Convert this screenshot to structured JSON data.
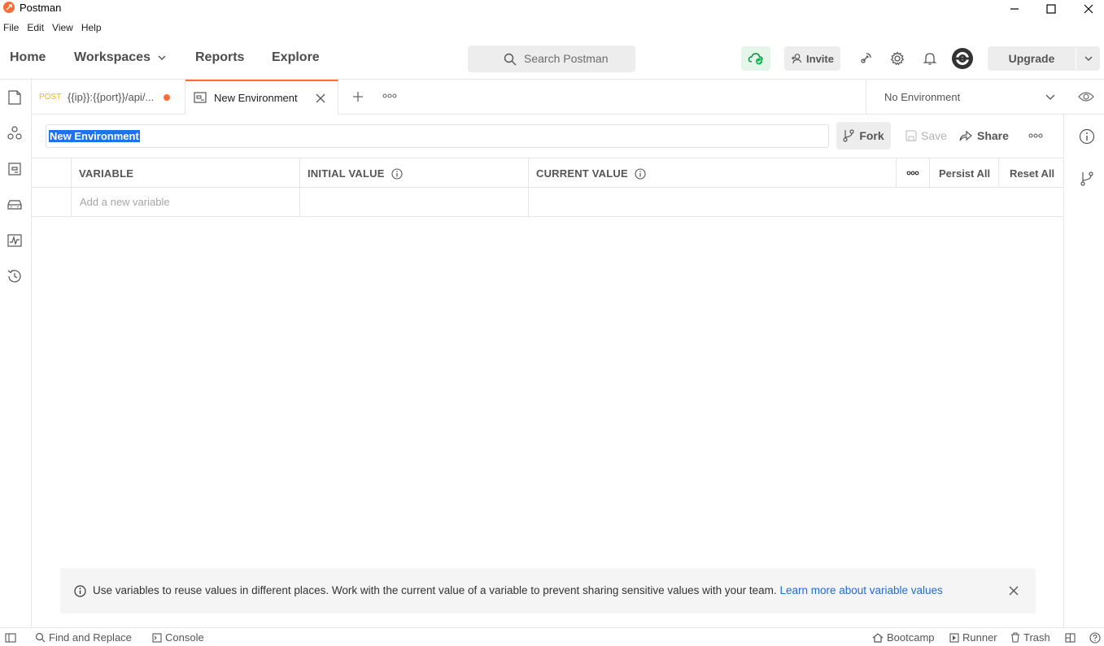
{
  "window": {
    "title": "Postman"
  },
  "menu": [
    "File",
    "Edit",
    "View",
    "Help"
  ],
  "header": {
    "home": "Home",
    "workspaces": "Workspaces",
    "reports": "Reports",
    "explore": "Explore",
    "search_placeholder": "Search Postman",
    "invite": "Invite",
    "upgrade": "Upgrade"
  },
  "tabs": [
    {
      "method": "POST",
      "label": "{{ip}}:{{port}}/api/...",
      "unsaved": true
    },
    {
      "label": "New Environment",
      "active": true
    }
  ],
  "environment_selector": "No Environment",
  "editor": {
    "name": "New Environment",
    "fork": "Fork",
    "save": "Save",
    "share": "Share"
  },
  "table": {
    "columns": [
      "VARIABLE",
      "INITIAL VALUE",
      "CURRENT VALUE"
    ],
    "persist_all": "Persist All",
    "reset_all": "Reset All",
    "new_row_placeholder": "Add a new variable"
  },
  "banner": {
    "text": "Use variables to reuse values in different places. Work with the current value of a variable to prevent sharing sensitive values with your team.",
    "link": "Learn more about variable values"
  },
  "statusbar": {
    "find_replace": "Find and Replace",
    "console": "Console",
    "bootcamp": "Bootcamp",
    "runner": "Runner",
    "trash": "Trash"
  },
  "colors": {
    "accent": "#ff6c37",
    "link": "#1d6bd6",
    "selection": "#1e73e8",
    "sync_ok": "#0cbb52",
    "method_post": "#ffb400"
  }
}
